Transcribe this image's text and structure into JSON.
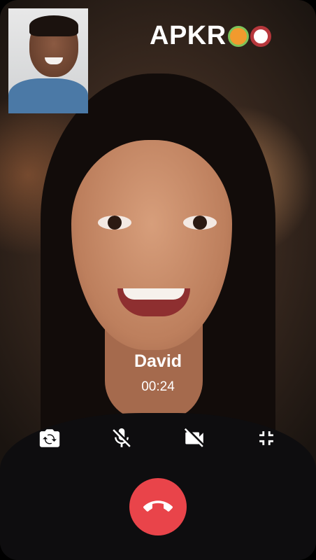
{
  "call": {
    "caller_name": "David",
    "duration": "00:24"
  },
  "logo": {
    "text": "APKR",
    "text_suffix": "O"
  },
  "controls": [
    {
      "name": "switch-camera",
      "icon": "camera-rotate-icon"
    },
    {
      "name": "mute-microphone",
      "icon": "mic-off-icon"
    },
    {
      "name": "video-off",
      "icon": "videocam-off-icon"
    },
    {
      "name": "minimize-call",
      "icon": "fullscreen-exit-icon"
    }
  ],
  "end_call": {
    "icon": "call-end-icon",
    "color": "#e9444a"
  }
}
